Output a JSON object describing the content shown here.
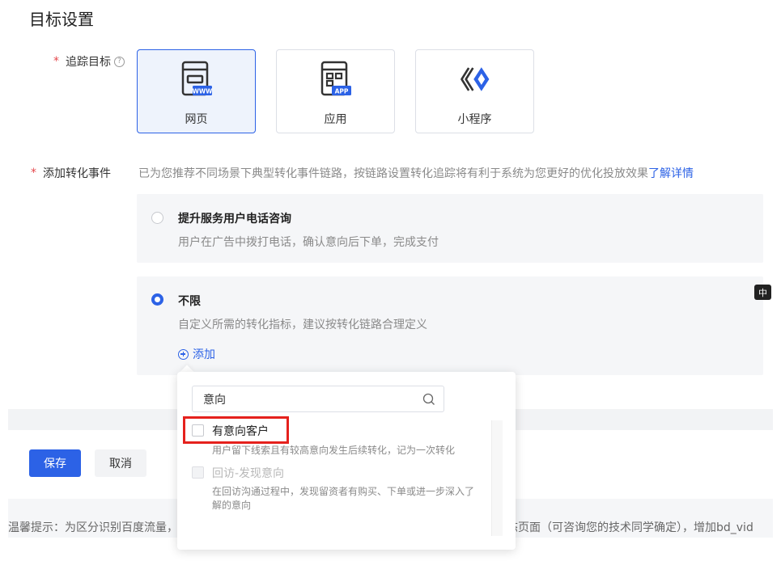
{
  "section": {
    "title": "目标设置"
  },
  "tracking": {
    "required_mark": "*",
    "label": "追踪目标",
    "help": "?",
    "cards": [
      {
        "label": "网页",
        "badge": "WWW",
        "selected": true
      },
      {
        "label": "应用",
        "badge": "APP",
        "selected": false
      },
      {
        "label": "小程序",
        "selected": false
      }
    ]
  },
  "conversion": {
    "required_mark": "*",
    "label": "添加转化事件",
    "hint": "已为您推荐不同场景下典型转化事件链路，按链路设置转化追踪将有利于系统为您更好的优化投放效果",
    "hint_link": "了解详情",
    "options": [
      {
        "title": "提升服务用户电话咨询",
        "desc": "用户在广告中拨打电话，确认意向后下单，完成支付",
        "checked": false
      },
      {
        "title": "不限",
        "desc": "自定义所需的转化指标，建议按转化链路合理定义",
        "checked": true
      }
    ],
    "add_label": "添加"
  },
  "ime_indicator": "中",
  "dropdown": {
    "search_value": "意向",
    "items": [
      {
        "title": "有意向客户",
        "desc": "用户留下线索且有较高意向发生后续转化，记为一次转化",
        "disabled": false
      },
      {
        "title": "回访-发现意向",
        "desc_line1": "在回访沟通过程中，发现留资者有购买、下单或进一步深入了",
        "desc_line2": "解的意向",
        "disabled": true
      }
    ]
  },
  "actions": {
    "save": "保存",
    "cancel": "取消"
  },
  "notice": {
    "left": "温馨提示：为区分识别百度流量，",
    "right": "态页面（可咨询您的技术同学确定），增加bd_vid"
  },
  "colors": {
    "primary": "#2c62e6",
    "required": "#e5484d",
    "highlight": "#e5211d"
  }
}
